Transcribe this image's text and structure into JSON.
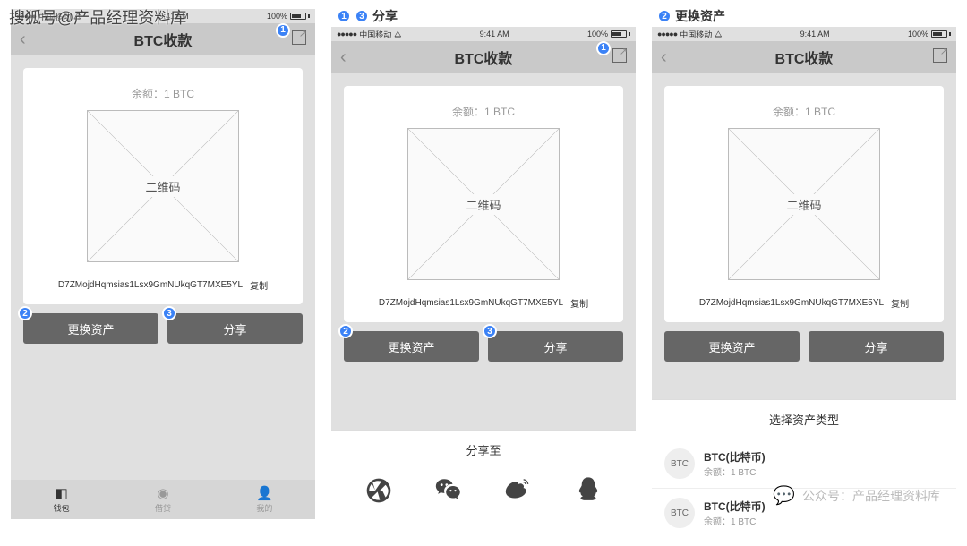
{
  "watermark_top": "搜狐号@产品经理资料库",
  "watermark_bottom": "公众号：产品经理资料库",
  "status": {
    "carrier": "中国移动",
    "time": "9:41 AM",
    "battery": "100%"
  },
  "nav": {
    "title": "BTC收款"
  },
  "balance_label": "余额：1 BTC",
  "qr_label": "二维码",
  "address": "D7ZMojdHqmsias1Lsx9GmNUkqGT7MXE5YL",
  "copy_label": "复制",
  "buttons": {
    "change_asset": "更换资产",
    "share": "分享"
  },
  "tabs": {
    "wallet": "钱包",
    "loan": "借贷",
    "mine": "我的"
  },
  "screen2_label": "分享",
  "screen3_label": "更换资产",
  "share_sheet_title": "分享至",
  "asset_sheet_title": "选择资产类型",
  "assets": [
    {
      "symbol": "BTC",
      "name": "BTC(比特币)",
      "balance": "余额：1 BTC"
    },
    {
      "symbol": "BTC",
      "name": "BTC(比特币)",
      "balance": "余额：1 BTC"
    }
  ],
  "badges": {
    "b1": "1",
    "b2": "2",
    "b3": "3"
  }
}
